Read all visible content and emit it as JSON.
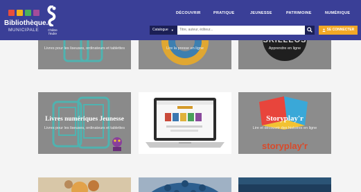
{
  "header": {
    "logo_title": "Bibliothèque.",
    "logo_subtitle": "MUNICIPALE",
    "emblem_text": "Châtre l'Indre",
    "logo_colors": [
      "#e94e3c",
      "#f4b41a",
      "#4bb25a",
      "#a44c9a"
    ],
    "nav": [
      "DÉCOUVRIR",
      "PRATIQUE",
      "JEUNESSE",
      "PATRIMOINE",
      "NUMÉRIQUE"
    ],
    "catalog_label": "Catalogue",
    "search_placeholder": "Titre, auteur, éditeur...",
    "connect_label": "SE CONNECTER"
  },
  "tiles": [
    {
      "title": "",
      "subtitle": "Livres pour les liseuses, ordinateurs et tablettes"
    },
    {
      "title": "",
      "subtitle": "Lire la presse en ligne"
    },
    {
      "title": "",
      "subtitle": "Apprendre en ligne",
      "brand": "SKILLEOS"
    },
    {
      "title": "Livres numériques Jeunesse",
      "subtitle": "Livres pour les liseuses, ordinateurs et tablettes"
    },
    {
      "title": "",
      "subtitle": ""
    },
    {
      "title": "Storyplay'r",
      "subtitle": "Lire et découvrir des histoires en ligne",
      "brand": "storyplay'r"
    },
    {
      "title": "",
      "subtitle": ""
    },
    {
      "title": "",
      "subtitle": ""
    },
    {
      "title": "",
      "subtitle": ""
    }
  ]
}
